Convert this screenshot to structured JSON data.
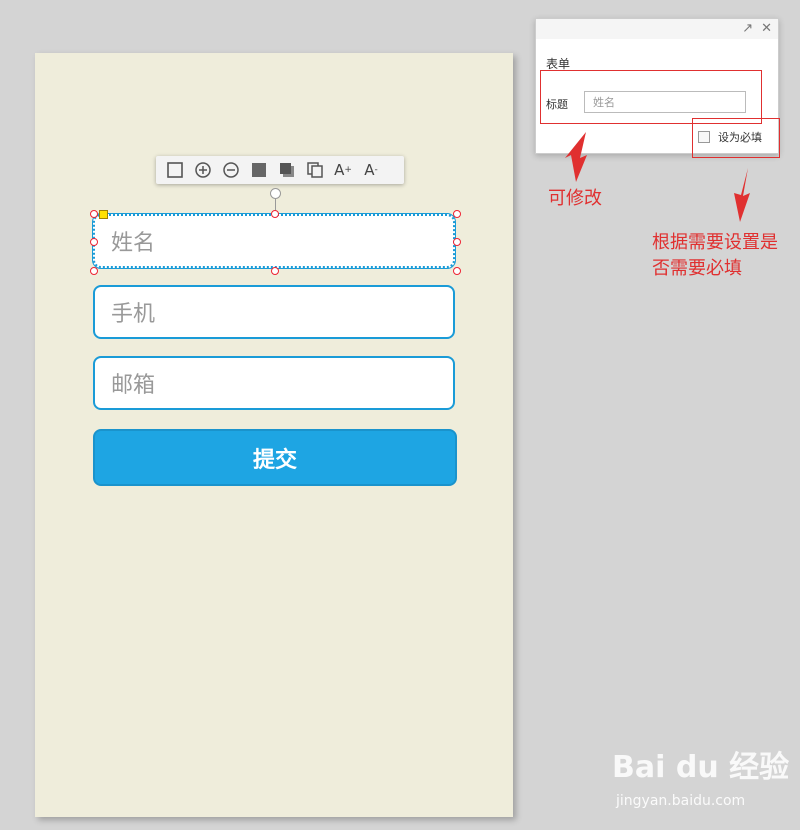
{
  "form": {
    "fields": [
      {
        "placeholder": "姓名"
      },
      {
        "placeholder": "手机"
      },
      {
        "placeholder": "邮箱"
      }
    ],
    "submit_label": "提交"
  },
  "toolbar": {
    "buttons": [
      "square-outline-icon",
      "zoom-in-icon",
      "zoom-out-icon",
      "fill-square-icon",
      "bring-front-icon",
      "copy-icon",
      "font-increase-icon",
      "font-decrease-icon"
    ],
    "font_increase": "A",
    "font_decrease": "A"
  },
  "panel": {
    "section_title": "表单",
    "title_label": "标题",
    "title_value": "姓名",
    "required_label": "设为必填",
    "required_checked": false
  },
  "annotations": {
    "editable": "可修改",
    "required_note_line1": "根据需要设置是",
    "required_note_line2": "否需要必填"
  },
  "watermark": {
    "logo": "Bai du 经验",
    "url": "jingyan.baidu.com"
  },
  "colors": {
    "accent": "#1a9bd7",
    "submit_bg": "#1ea5e3",
    "annotation": "#e03030",
    "canvas_bg": "#efeddb"
  }
}
